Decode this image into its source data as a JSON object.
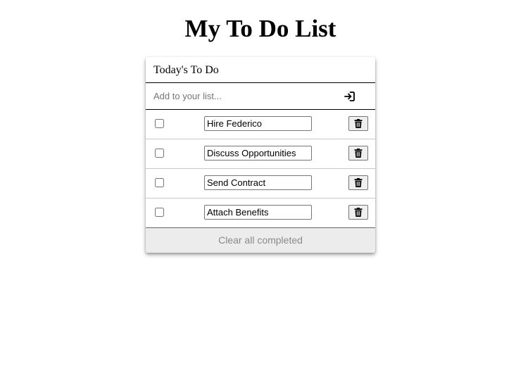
{
  "page": {
    "title": "My To Do List"
  },
  "card": {
    "header_title": "Today's To Do",
    "add": {
      "placeholder": "Add to your list...",
      "value": "",
      "button_icon": "sign-in-arrow-icon"
    },
    "items": [
      {
        "text": "Hire Federico",
        "checked": false,
        "delete_icon": "trash-icon"
      },
      {
        "text": "Discuss Opportunities",
        "checked": false,
        "delete_icon": "trash-icon"
      },
      {
        "text": "Send Contract",
        "checked": false,
        "delete_icon": "trash-icon"
      },
      {
        "text": "Attach Benefits",
        "checked": false,
        "delete_icon": "trash-icon"
      }
    ],
    "footer_label": "Clear all completed"
  },
  "colors": {
    "footer_background": "#ececec",
    "footer_text": "#8a8a8a",
    "divider": "#000000"
  }
}
